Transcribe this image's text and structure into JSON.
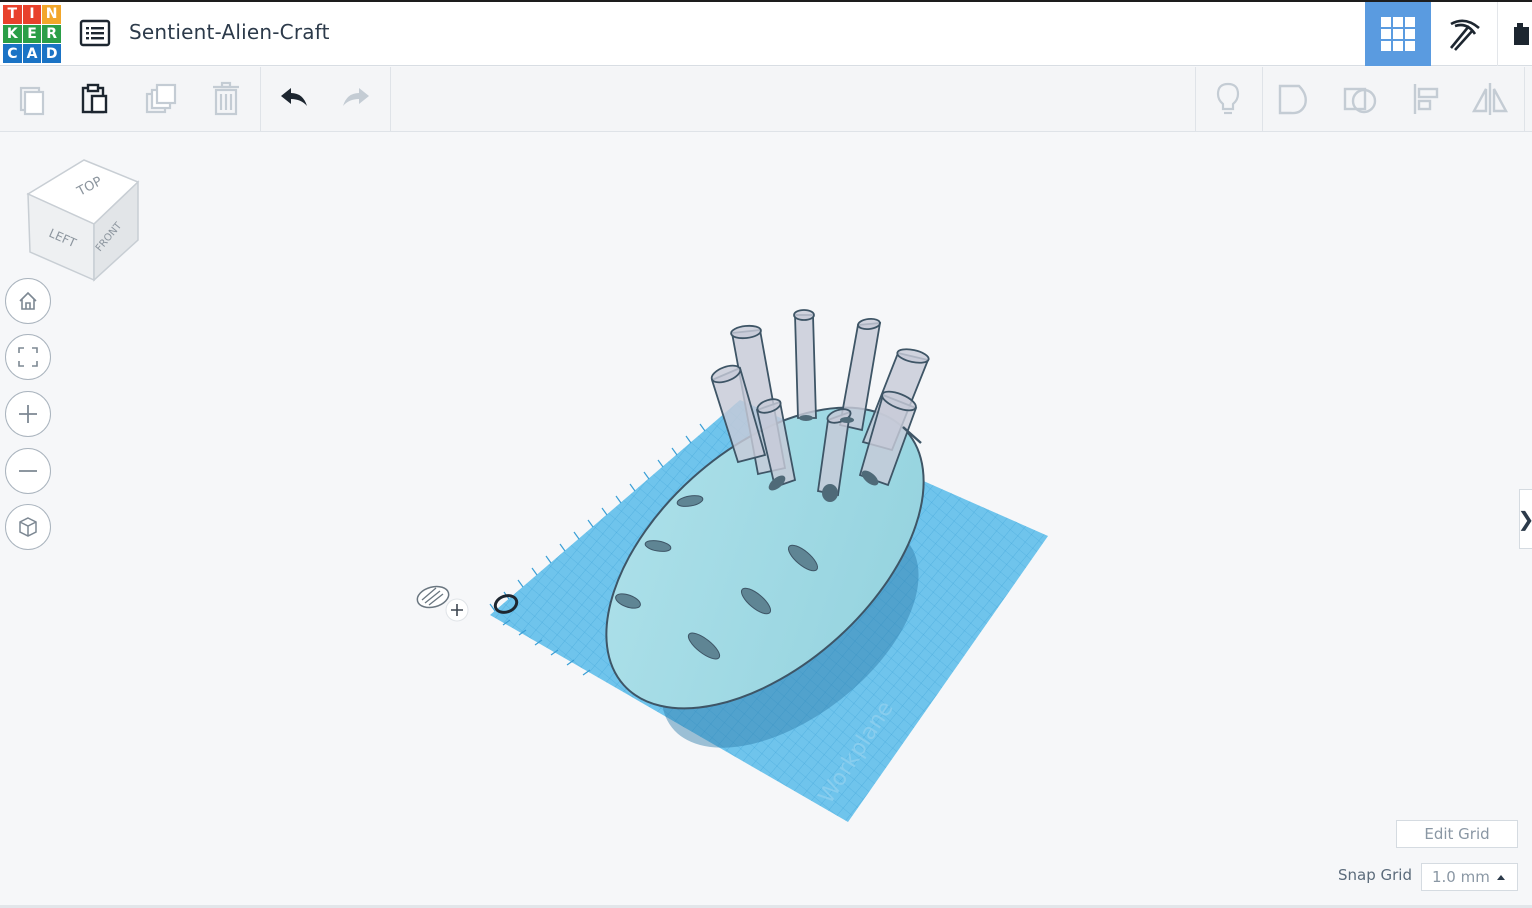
{
  "app": {
    "logo_letters": [
      "T",
      "I",
      "N",
      "K",
      "E",
      "R",
      "C",
      "A",
      "D"
    ],
    "logo_colors": [
      "#e8412c",
      "#e8412c",
      "#f2a62a",
      "#2a9e47",
      "#2a9e47",
      "#2a9e47",
      "#1a73c5",
      "#1a73c5",
      "#1a73c5"
    ],
    "title": "Sentient-Alien-Craft",
    "accent": "#5a9be0"
  },
  "header": {
    "icons": [
      "menu-icon",
      "grid-view-icon",
      "pickaxe-icon",
      "bricks-icon"
    ]
  },
  "toolbar": {
    "left_icons": [
      "copy-icon",
      "paste-icon",
      "duplicate-icon",
      "delete-icon",
      "undo-icon",
      "redo-icon"
    ],
    "right_icons": [
      "lightbulb-icon",
      "group-icon",
      "ungroup-icon",
      "align-icon",
      "mirror-icon"
    ]
  },
  "view_cube": {
    "top": "TOP",
    "left": "LEFT",
    "front": "FRONT"
  },
  "view_controls": [
    "home-icon",
    "fit-icon",
    "zoom-in-icon",
    "zoom-out-icon",
    "orthographic-icon"
  ],
  "workplane": {
    "label": "Workplane",
    "color": "#5bb8e6"
  },
  "grid": {
    "edit_label": "Edit Grid",
    "snap_label": "Snap Grid",
    "snap_value": "1.0 mm"
  },
  "panel_toggle": "❯"
}
